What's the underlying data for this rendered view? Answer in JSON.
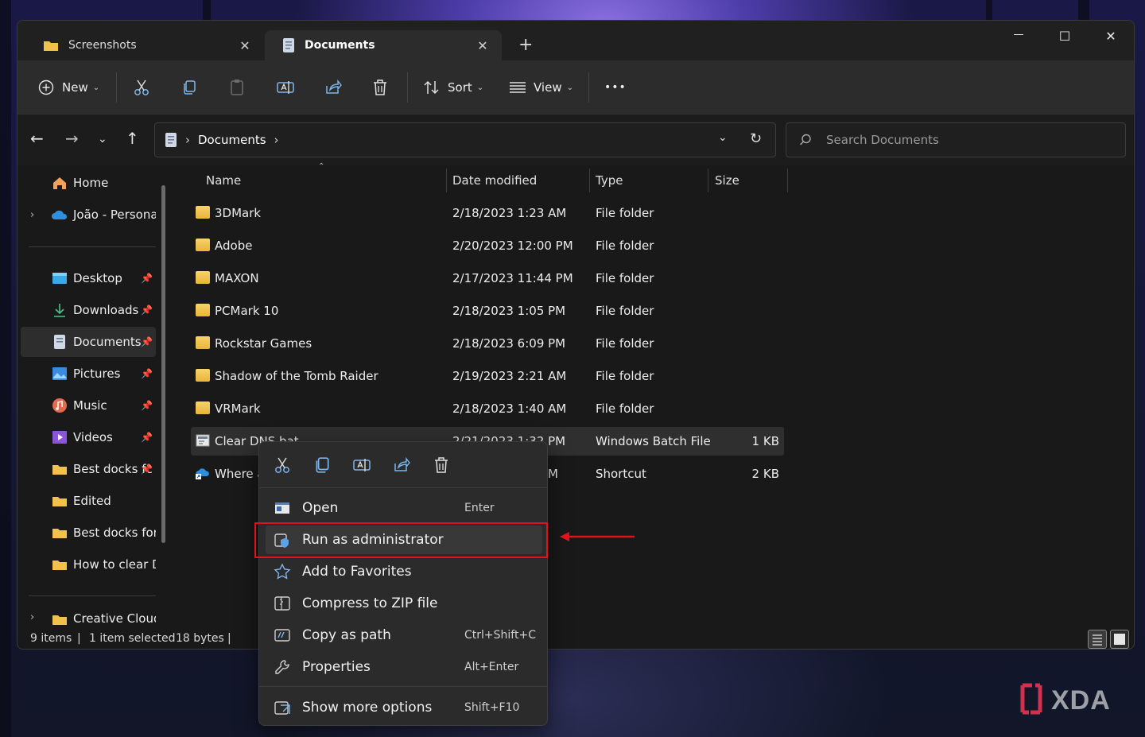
{
  "tabs": [
    {
      "label": "Screenshots",
      "close": "✕"
    },
    {
      "label": "Documents",
      "close": "✕"
    }
  ],
  "new_tab": "+",
  "window_controls": {
    "minimize": "—",
    "maximize": "☐",
    "close": "✕"
  },
  "toolbar": {
    "new_label": "New",
    "sort_label": "Sort",
    "view_label": "View",
    "more_label": "•••",
    "icons": [
      "cut-icon",
      "copy-icon",
      "paste-icon",
      "rename-icon",
      "share-icon",
      "delete-icon"
    ]
  },
  "address": {
    "crumbs": [
      "Documents"
    ],
    "separator": "›"
  },
  "search": {
    "placeholder": "Search Documents"
  },
  "sidebar": {
    "items": [
      {
        "label": "Home",
        "icon": "home-icon",
        "pinned": false
      },
      {
        "label": "João - Personal",
        "icon": "onedrive-icon",
        "pinned": false,
        "expandable": true
      },
      {
        "label": "Desktop",
        "icon": "desktop-icon",
        "pinned": true
      },
      {
        "label": "Downloads",
        "icon": "download-icon",
        "pinned": true
      },
      {
        "label": "Documents",
        "icon": "documents-icon",
        "pinned": true,
        "active": true
      },
      {
        "label": "Pictures",
        "icon": "pictures-icon",
        "pinned": true
      },
      {
        "label": "Music",
        "icon": "music-icon",
        "pinned": true
      },
      {
        "label": "Videos",
        "icon": "videos-icon",
        "pinned": true
      },
      {
        "label": "Best docks fc",
        "icon": "folder-icon",
        "pinned": true
      },
      {
        "label": "Edited",
        "icon": "folder-icon",
        "pinned": false
      },
      {
        "label": "Best docks for S",
        "icon": "folder-icon",
        "pinned": false
      },
      {
        "label": "How to clear DN",
        "icon": "folder-icon",
        "pinned": false
      },
      {
        "label": "Creative Cloud F",
        "icon": "folder-icon",
        "pinned": false
      }
    ],
    "pin_glyph": "📌"
  },
  "columns": {
    "name": "Name",
    "date": "Date modified",
    "type": "Type",
    "size": "Size"
  },
  "files": [
    {
      "name": "3DMark",
      "date": "2/18/2023 1:23 AM",
      "type": "File folder",
      "size": "",
      "icon": "folder-icon"
    },
    {
      "name": "Adobe",
      "date": "2/20/2023 12:00 PM",
      "type": "File folder",
      "size": "",
      "icon": "folder-icon"
    },
    {
      "name": "MAXON",
      "date": "2/17/2023 11:44 PM",
      "type": "File folder",
      "size": "",
      "icon": "folder-icon"
    },
    {
      "name": "PCMark 10",
      "date": "2/18/2023 1:05 PM",
      "type": "File folder",
      "size": "",
      "icon": "folder-icon"
    },
    {
      "name": "Rockstar Games",
      "date": "2/18/2023 6:09 PM",
      "type": "File folder",
      "size": "",
      "icon": "folder-icon"
    },
    {
      "name": "Shadow of the Tomb Raider",
      "date": "2/19/2023 2:21 AM",
      "type": "File folder",
      "size": "",
      "icon": "folder-icon"
    },
    {
      "name": "VRMark",
      "date": "2/18/2023 1:40 AM",
      "type": "File folder",
      "size": "",
      "icon": "folder-icon"
    },
    {
      "name": "Clear DNS.bat",
      "date": "2/21/2023 1:32 PM",
      "type": "Windows Batch File",
      "size": "1 KB",
      "icon": "batch-file-icon",
      "selected": true
    },
    {
      "name": "Where a",
      "date": "M",
      "type": "Shortcut",
      "size": "2 KB",
      "icon": "shortcut-icon"
    }
  ],
  "status": {
    "items_count": "9 items",
    "selected": "1 item selected",
    "bytes": "18 bytes",
    "sep": "|"
  },
  "context_menu": {
    "quick_actions": [
      "cut-icon",
      "copy-icon",
      "rename-icon",
      "share-icon",
      "delete-icon"
    ],
    "items": [
      {
        "label": "Open",
        "shortcut": "Enter",
        "icon": "open-icon"
      },
      {
        "label": "Run as administrator",
        "shortcut": "",
        "icon": "run-as-admin-icon",
        "highlighted": true
      },
      {
        "label": "Add to Favorites",
        "shortcut": "",
        "icon": "star-icon"
      },
      {
        "label": "Compress to ZIP file",
        "shortcut": "",
        "icon": "zip-icon"
      },
      {
        "label": "Copy as path",
        "shortcut": "Ctrl+Shift+C",
        "icon": "copy-path-icon"
      },
      {
        "label": "Properties",
        "shortcut": "Alt+Enter",
        "icon": "properties-icon"
      },
      {
        "label": "Show more options",
        "shortcut": "Shift+F10",
        "icon": "more-options-icon"
      }
    ]
  },
  "annotation": {
    "color": "#e0121b"
  },
  "watermark": "XDA",
  "colors": {
    "accent": "#60cdff",
    "folder": "#f0c24a",
    "annotation": "#e0121b"
  }
}
